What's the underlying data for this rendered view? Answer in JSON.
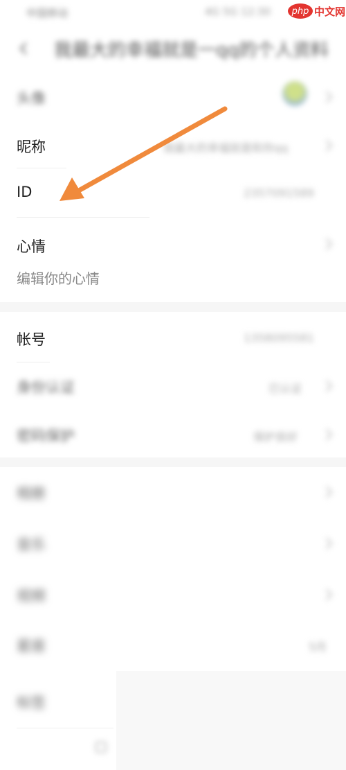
{
  "status_bar": {
    "left_text": "中国移动",
    "right_text": "4G 5G 12:30",
    "logo_php": "php",
    "logo_cn": "中文网"
  },
  "nav": {
    "title": "我最大的幸福就是一qq的个人资料"
  },
  "profile": {
    "avatar_label": "头像",
    "nickname_label": "昵称",
    "nickname_value": "我最大的幸福就是和你qq",
    "id_label": "ID",
    "id_value": "2357091589",
    "mood_label": "心情",
    "mood_hint": "编辑你的心情"
  },
  "account": {
    "account_label": "帐号",
    "account_value": "1358095581",
    "identity_label": "身份认证",
    "identity_value": "已认证",
    "security_label": "密码保护",
    "security_value": "保护良好"
  },
  "more": {
    "item1_label": "相册",
    "item2_label": "音乐",
    "item3_label": "视频",
    "item4_label": "星座",
    "item4_value": "5月",
    "item5_label": "标签"
  },
  "colors": {
    "arrow": "#f08a3c",
    "logo_red": "#e3342f"
  }
}
